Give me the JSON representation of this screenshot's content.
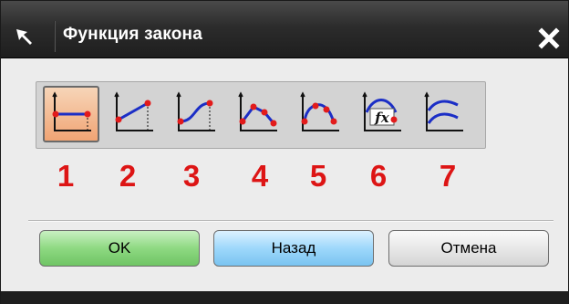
{
  "window": {
    "title": "Функция закона",
    "close_icon": "close-x-icon",
    "app_icon": "arrow-cursor-icon"
  },
  "tools": [
    {
      "name": "constant",
      "icon": "law-constant-icon",
      "selected": true
    },
    {
      "name": "linear",
      "icon": "law-linear-icon",
      "selected": false
    },
    {
      "name": "cubic",
      "icon": "law-cubic-icon",
      "selected": false
    },
    {
      "name": "linear-along-spine",
      "icon": "law-linear-spine-icon",
      "selected": false
    },
    {
      "name": "cubic-along-spine",
      "icon": "law-cubic-spine-icon",
      "selected": false
    },
    {
      "name": "by-equation",
      "icon": "law-equation-fx-icon",
      "selected": false
    },
    {
      "name": "by-curve",
      "icon": "law-curve-icon",
      "selected": false
    }
  ],
  "numbers": [
    "1",
    "2",
    "3",
    "4",
    "5",
    "6",
    "7"
  ],
  "buttons": {
    "ok": "OK",
    "back": "Назад",
    "cancel": "Отмена"
  },
  "colors": {
    "annotation": "#dd1515",
    "ok": "#8ed982",
    "back": "#9ed8fb",
    "selected_tool": "#f0a474"
  }
}
